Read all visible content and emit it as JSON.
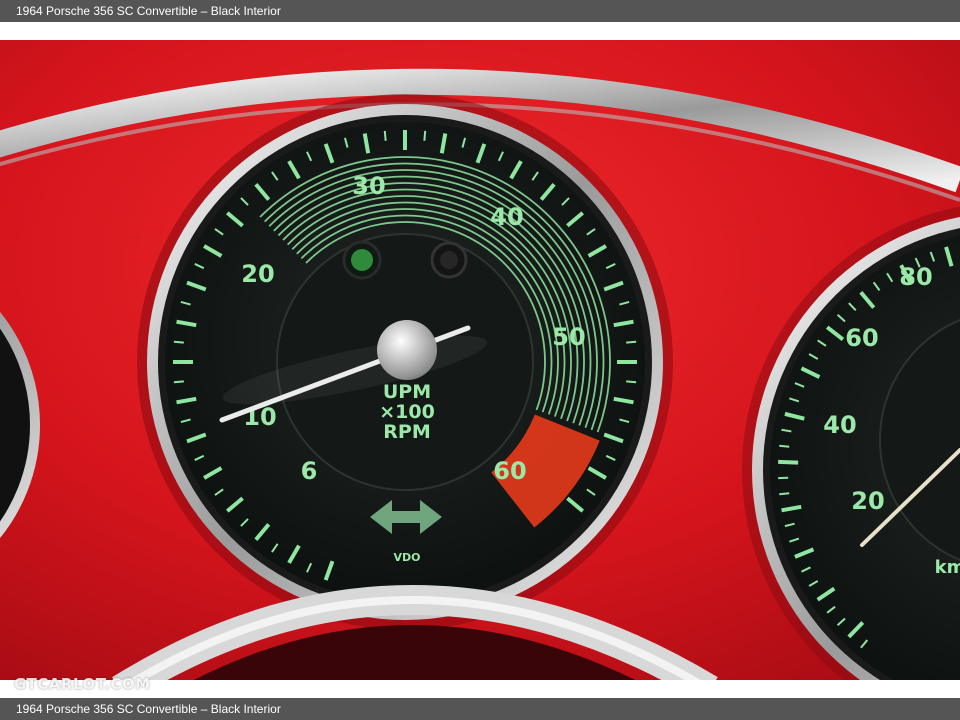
{
  "header": {
    "title": "1964 Porsche 356 SC Convertible – Black Interior"
  },
  "footer": {
    "title": "1964 Porsche 356 SC Convertible – Black Interior"
  },
  "watermark": {
    "text": "GTCARLOT.COM"
  },
  "photo": {
    "subject": "dashboard-gauges",
    "colors": {
      "dash": "#d4141c",
      "gauge_face": "#111513",
      "markings": "#8fe6a0",
      "redline": "#e83a1a",
      "chrome": "#e6e6e6"
    },
    "tachometer": {
      "numbers": [
        "6",
        "10",
        "20",
        "30",
        "40",
        "50",
        "60"
      ],
      "unit_line1": "UPM",
      "unit_line2": "×100",
      "unit_line3": "RPM",
      "brand": "VDO"
    },
    "speedometer": {
      "numbers": [
        "20",
        "40",
        "60",
        "80"
      ],
      "unit_fragment": "km"
    },
    "badge_colors": [
      "#7dc242",
      "#f7941d",
      "#f2c200"
    ]
  }
}
